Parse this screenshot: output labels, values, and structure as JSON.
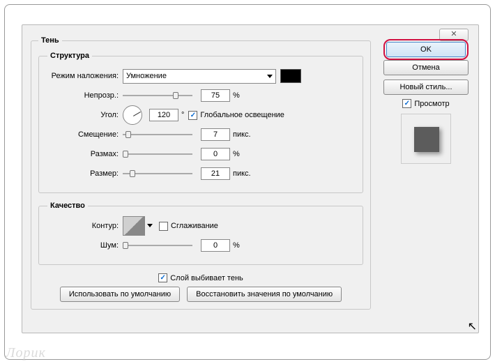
{
  "window": {
    "close": "✕"
  },
  "shadow": {
    "legend": "Тень",
    "structure": {
      "legend": "Структура",
      "blend_label": "Режим наложения:",
      "blend_value": "Умножение",
      "opacity_label": "Непрозр.:",
      "opacity_value": "75",
      "opacity_unit": "%",
      "angle_label": "Угол:",
      "angle_value": "120",
      "angle_unit": "°",
      "global_light": "Глобальное освещение",
      "distance_label": "Смещение:",
      "distance_value": "7",
      "distance_unit": "пикс.",
      "spread_label": "Размах:",
      "spread_value": "0",
      "spread_unit": "%",
      "size_label": "Размер:",
      "size_value": "21",
      "size_unit": "пикс."
    },
    "quality": {
      "legend": "Качество",
      "contour_label": "Контур:",
      "antialias": "Сглаживание",
      "noise_label": "Шум:",
      "noise_value": "0",
      "noise_unit": "%"
    },
    "knockout": "Слой выбивает тень",
    "btn_default": "Использовать по умолчанию",
    "btn_reset": "Восстановить значения по умолчанию"
  },
  "side": {
    "ok": "OK",
    "cancel": "Отмена",
    "newstyle": "Новый стиль...",
    "preview": "Просмотр"
  },
  "watermark": "Лорик"
}
